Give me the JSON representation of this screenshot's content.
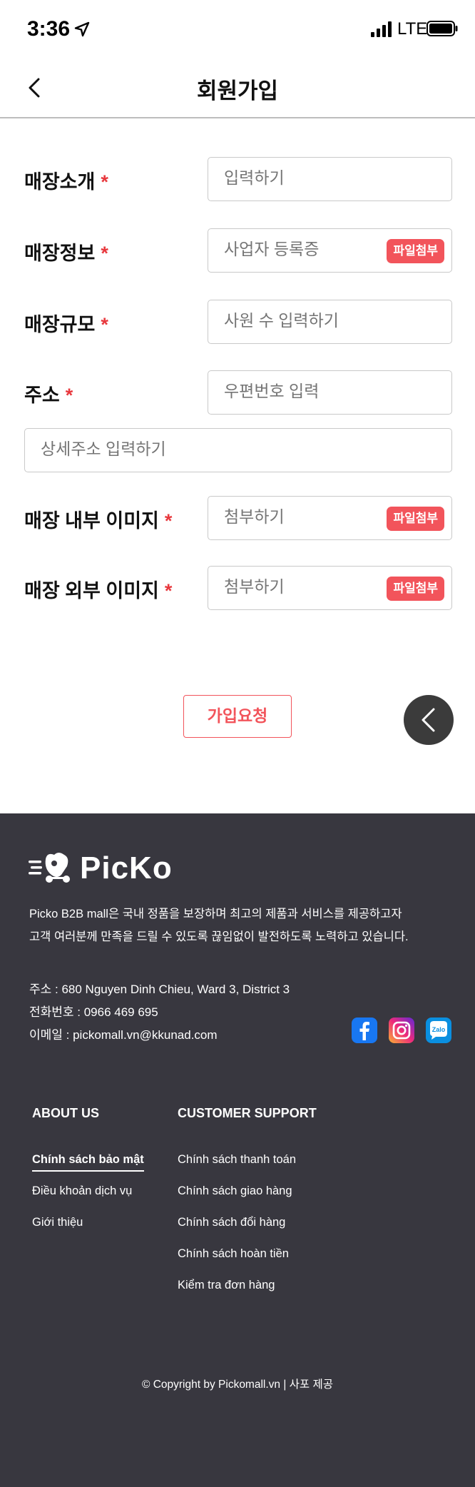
{
  "status_bar": {
    "time": "3:36",
    "network": "LTE"
  },
  "header": {
    "title": "회원가입"
  },
  "form": {
    "fields": [
      {
        "label": "매장소개",
        "placeholder": "입력하기"
      },
      {
        "label": "매장정보",
        "placeholder": "사업자 등록증",
        "attach": "파일첨부"
      },
      {
        "label": "매장규모",
        "placeholder": "사원 수 입력하기"
      },
      {
        "label": "주소",
        "placeholder": "우편번호 입력"
      },
      {
        "placeholder": "상세주소 입력하기"
      },
      {
        "label": "매장 내부 이미지",
        "placeholder": "첨부하기",
        "attach": "파일첨부"
      },
      {
        "label": "매장 외부 이미지",
        "placeholder": "첨부하기",
        "attach": "파일첨부"
      }
    ],
    "required_mark": "*",
    "submit": "가입요청"
  },
  "footer": {
    "logo": "PicKo",
    "description": [
      "Picko B2B mall은 국내 정품을 보장하며 최고의 제품과 서비스를 제공하고자",
      "고객 여러분께 만족을 드릴 수 있도록 끊임없이 발전하도록 노력하고 있습니다."
    ],
    "address": "주소 : 680 Nguyen Dinh Chieu, Ward 3, District 3",
    "phone": "전화번호 : 0966 469 695",
    "email": "이메일 : pickomall.vn@kkunad.com",
    "social": [
      "facebook-icon",
      "instagram-icon",
      "zalo-icon"
    ],
    "zalo_label": "Zalo",
    "about": {
      "heading": "ABOUT US",
      "links": [
        "Chính sách bảo mật",
        "Điều khoản dịch vụ",
        "Giới thiệu"
      ]
    },
    "support": {
      "heading": "CUSTOMER SUPPORT",
      "links": [
        "Chính sách thanh toán",
        "Chính sách giao hàng",
        "Chính sách đổi hàng",
        "Chính sách hoàn tiền",
        "Kiểm tra đơn hàng"
      ]
    },
    "copyright": "© Copyright by Pickomall.vn | 사포 제공"
  },
  "colors": {
    "accent": "#f2545b",
    "footer_bg": "#38373f",
    "required": "#e8383d"
  }
}
